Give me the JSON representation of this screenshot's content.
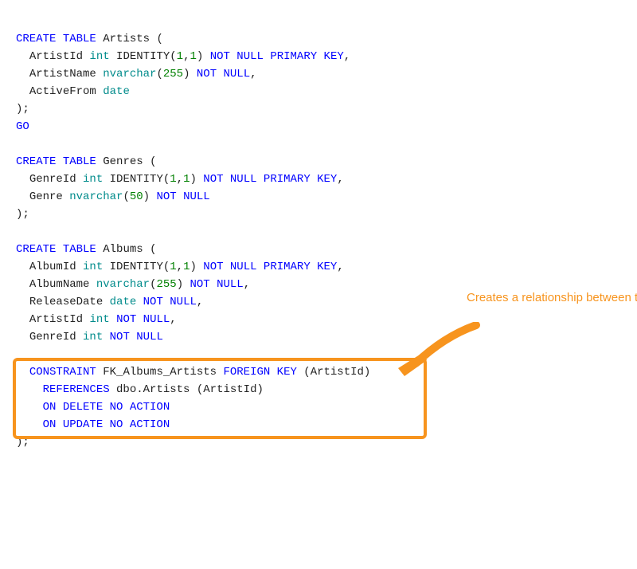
{
  "sql": {
    "create": "CREATE",
    "table": "TABLE",
    "artists": "Artists",
    "genres": "Genres",
    "albums": "Albums",
    "open": " (",
    "close": ");",
    "go": "GO",
    "artistId": "ArtistId",
    "artistName": "ArtistName",
    "activeFrom": "ActiveFrom",
    "genreId": "GenreId",
    "genre": "Genre",
    "albumId": "AlbumId",
    "albumName": "AlbumName",
    "releaseDate": "ReleaseDate",
    "int": "int",
    "date": "date",
    "nvarchar": "nvarchar",
    "n255": "255",
    "n50": "50",
    "n1": "1",
    "identityOpen": " IDENTITY(",
    "identityComma": ",",
    "identityClose": ")",
    "parenOpen": "(",
    "parenClose": ")",
    "comma": ",",
    "notNull": "NOT NULL",
    "primaryKey": "PRIMARY KEY",
    "constraint": "CONSTRAINT",
    "fkName": "FK_Albums_Artists",
    "foreignKey": "FOREIGN KEY",
    "references": "REFERENCES",
    "dboArtists": "dbo.Artists",
    "onDelete": "ON DELETE NO ACTION",
    "onUpdate": "ON UPDATE NO ACTION"
  },
  "annotation": {
    "text": "Creates a relationship between the Albums and Artists tables."
  },
  "colors": {
    "highlight": "#f7941e"
  }
}
